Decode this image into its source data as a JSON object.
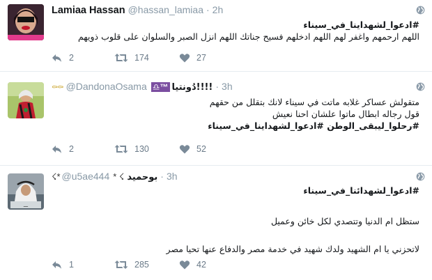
{
  "tweets": [
    {
      "name": "Lamiaa Hassan",
      "handle": "@hassan_lamiaa",
      "time": "2h",
      "lines": [
        "#ادعوا_لشهداينا_في_سيناء",
        "اللهم ارحمهم واغفر لهم اللهم ادخلهم فسيح جناتك اللهم انزل الصبر والسلوان على قلوب ذويهم"
      ],
      "replies": "2",
      "retweets": "174",
      "likes": "27"
    },
    {
      "name_prefix_emoji": "⚰⚰",
      "handle": "@DandonaOsama",
      "name_symbols": "♎™",
      "name": "دُونتيا!!!!",
      "time": "3h",
      "lines": [
        "متقولش عساكر غلابه ماتت في سيناء لانك بتقلل من حقهم",
        "قول رجاله ابطال ماتوا علشان احنا نعيش",
        "#رحلوا_ليبقى_الوطن #ادعوا_لشهداينا_في_سيناء"
      ],
      "replies": "2",
      "retweets": "130",
      "likes": "52"
    },
    {
      "name_prefix_emoji": "☇*",
      "handle": "@u5ae444",
      "name_suffix": "* ☇",
      "name": "بوحميد",
      "time": "3h",
      "lines": [
        "#ادعوا_لشهدائنا_في_سيناء",
        "ستظل ام الدنيا وتتصدي لكل خائن وعميل",
        "لاتحزني يا ام الشهيد ولدك شهيد في خدمة مصر والدفاع عنها تحيا مصر"
      ],
      "replies": "1",
      "retweets": "285",
      "likes": "42"
    }
  ],
  "icons": {
    "reply": "reply-icon",
    "retweet": "retweet-icon",
    "like": "heart-icon",
    "globe": "globe-icon"
  },
  "colors": {
    "text": "#14171a",
    "muted": "#8899a6",
    "action": "#6a7a88",
    "divider": "#e6ecf0"
  }
}
